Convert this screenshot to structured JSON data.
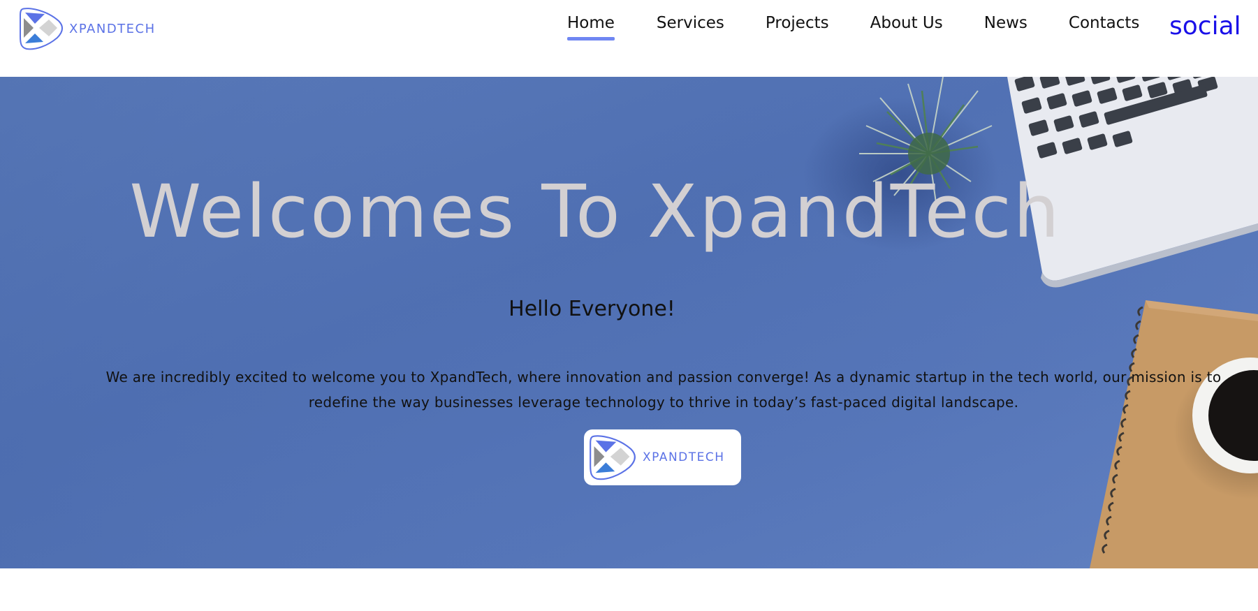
{
  "brand": {
    "name": "XPANDTECH",
    "colors": {
      "primary": "#5b72e6",
      "nav_active_underline": "#6f86f2",
      "social_link": "#1a10e8",
      "hero_background": "#5575b8",
      "hero_title": "#d3d0d2"
    }
  },
  "nav": {
    "items": [
      {
        "label": "Home",
        "active": true
      },
      {
        "label": "Services",
        "active": false
      },
      {
        "label": "Projects",
        "active": false
      },
      {
        "label": "About Us",
        "active": false
      },
      {
        "label": "News",
        "active": false
      },
      {
        "label": "Contacts",
        "active": false
      }
    ],
    "social_label": "social"
  },
  "hero": {
    "title": "Welcomes To XpandTech",
    "subtitle": "Hello Everyone!",
    "text": "We are incredibly excited to welcome you to XpandTech, where innovation and passion converge! As a dynamic startup in the tech world, our mission is to redefine the way businesses leverage technology to thrive in today’s fast-paced digital landscape.",
    "logo_text": "XPANDTECH"
  },
  "icons": {
    "logo": "xpandtech-logo-icon",
    "laptop": "laptop-image",
    "plant": "plant-image",
    "notebook": "notebook-image",
    "coffee": "coffee-cup-image"
  }
}
